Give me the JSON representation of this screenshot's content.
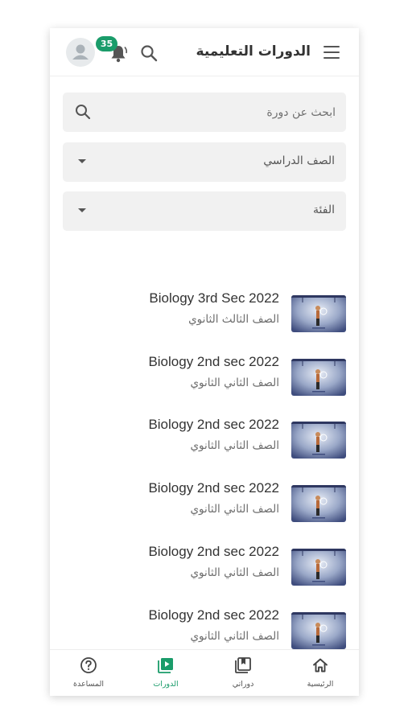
{
  "header": {
    "title": "الدورات التعليمية",
    "notification_count": "35",
    "icons": [
      "menu-icon",
      "search-icon",
      "bell-icon",
      "avatar-icon"
    ]
  },
  "filters": {
    "search_placeholder": "ابحث عن دورة",
    "grade_label": "الصف الدراسي",
    "category_label": "الفئة"
  },
  "courses": [
    {
      "title": "Biology 3rd Sec 2022",
      "subtitle": "الصف الثالث الثانوي"
    },
    {
      "title": "Biology 2nd sec 2022",
      "subtitle": "الصف الثاني الثانوي"
    },
    {
      "title": "Biology 2nd sec 2022",
      "subtitle": "الصف الثاني الثانوي"
    },
    {
      "title": "Biology 2nd sec 2022",
      "subtitle": "الصف الثاني الثانوي"
    },
    {
      "title": "Biology 2nd sec 2022",
      "subtitle": "الصف الثاني الثانوي"
    },
    {
      "title": "Biology 2nd sec 2022",
      "subtitle": "الصف الثاني الثانوي"
    }
  ],
  "bottom_nav": {
    "items": [
      {
        "label": "المساعدة",
        "icon": "help-icon",
        "active": false
      },
      {
        "label": "الدورات",
        "icon": "play-library-icon",
        "active": true
      },
      {
        "label": "دوراتي",
        "icon": "bookmark-library-icon",
        "active": false
      },
      {
        "label": "الرئيسية",
        "icon": "home-icon",
        "active": false
      }
    ]
  },
  "colors": {
    "accent": "#1a9c6a",
    "field_background": "#f1f1f1",
    "text": "#333333"
  }
}
